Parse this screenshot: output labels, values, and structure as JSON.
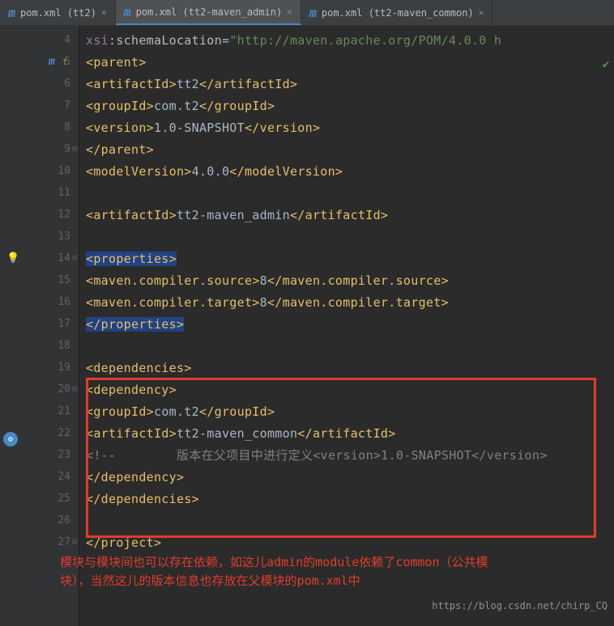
{
  "tabs": [
    {
      "label": "pom.xml (tt2)",
      "active": false
    },
    {
      "label": "pom.xml (tt2-maven_admin)",
      "active": true
    },
    {
      "label": "pom.xml (tt2-maven_common)",
      "active": false
    }
  ],
  "lines": {
    "l4": "4",
    "l5": "5",
    "l6": "6",
    "l7": "7",
    "l8": "8",
    "l9": "9",
    "l10": "10",
    "l11": "11",
    "l12": "12",
    "l13": "13",
    "l14": "14",
    "l15": "15",
    "l16": "16",
    "l17": "17",
    "l18": "18",
    "l19": "19",
    "l20": "20",
    "l21": "21",
    "l22": "22",
    "l23": "23",
    "l24": "24",
    "l25": "25",
    "l26": "26",
    "l27": "27"
  },
  "code": {
    "xsi": "xsi",
    "schemaLoc": ":schemaLocation",
    "eq": "=",
    "url": "\"http://maven.apache.org/POM/4.0.0 h",
    "parent_open": "<parent>",
    "parent_close": "</parent>",
    "artifactId_o": "<artifactId>",
    "artifactId_c": "</artifactId>",
    "groupId_o": "<groupId>",
    "groupId_c": "</groupId>",
    "version_o": "<version>",
    "version_c": "</version>",
    "modelVersion_o": "<modelVersion>",
    "modelVersion_c": "</modelVersion>",
    "properties_o": "<properties>",
    "properties_c": "</properties>",
    "mcs_o": "<maven.compiler.source>",
    "mcs_c": "</maven.compiler.source>",
    "mct_o": "<maven.compiler.target>",
    "mct_c": "</maven.compiler.target>",
    "dependencies_o": "<dependencies>",
    "dependencies_c": "</dependencies>",
    "dependency_o": "<dependency>",
    "dependency_c": "</dependency>",
    "project_c": "</project>",
    "tt2": "tt2",
    "comt2": "com.t2",
    "snapshot": "1.0-SNAPSHOT",
    "v400": "4.0.0",
    "admin": "tt2-maven_admin",
    "eight": "8",
    "common": "tt2-maven_common",
    "comment_start": "<!--",
    "comment_text": "        版本在父项目中进行定义",
    "comment_ver": "<version>1.0-SNAPSHOT</version>"
  },
  "annotation": {
    "text1": "模块与模块间也可以存在依赖，如这儿admin的module依赖了common（公共模",
    "text2": "块），当然这儿的版本信息也存放在父模块的pom.xml中"
  },
  "watermark": "https://blog.csdn.net/chirp_CQ"
}
